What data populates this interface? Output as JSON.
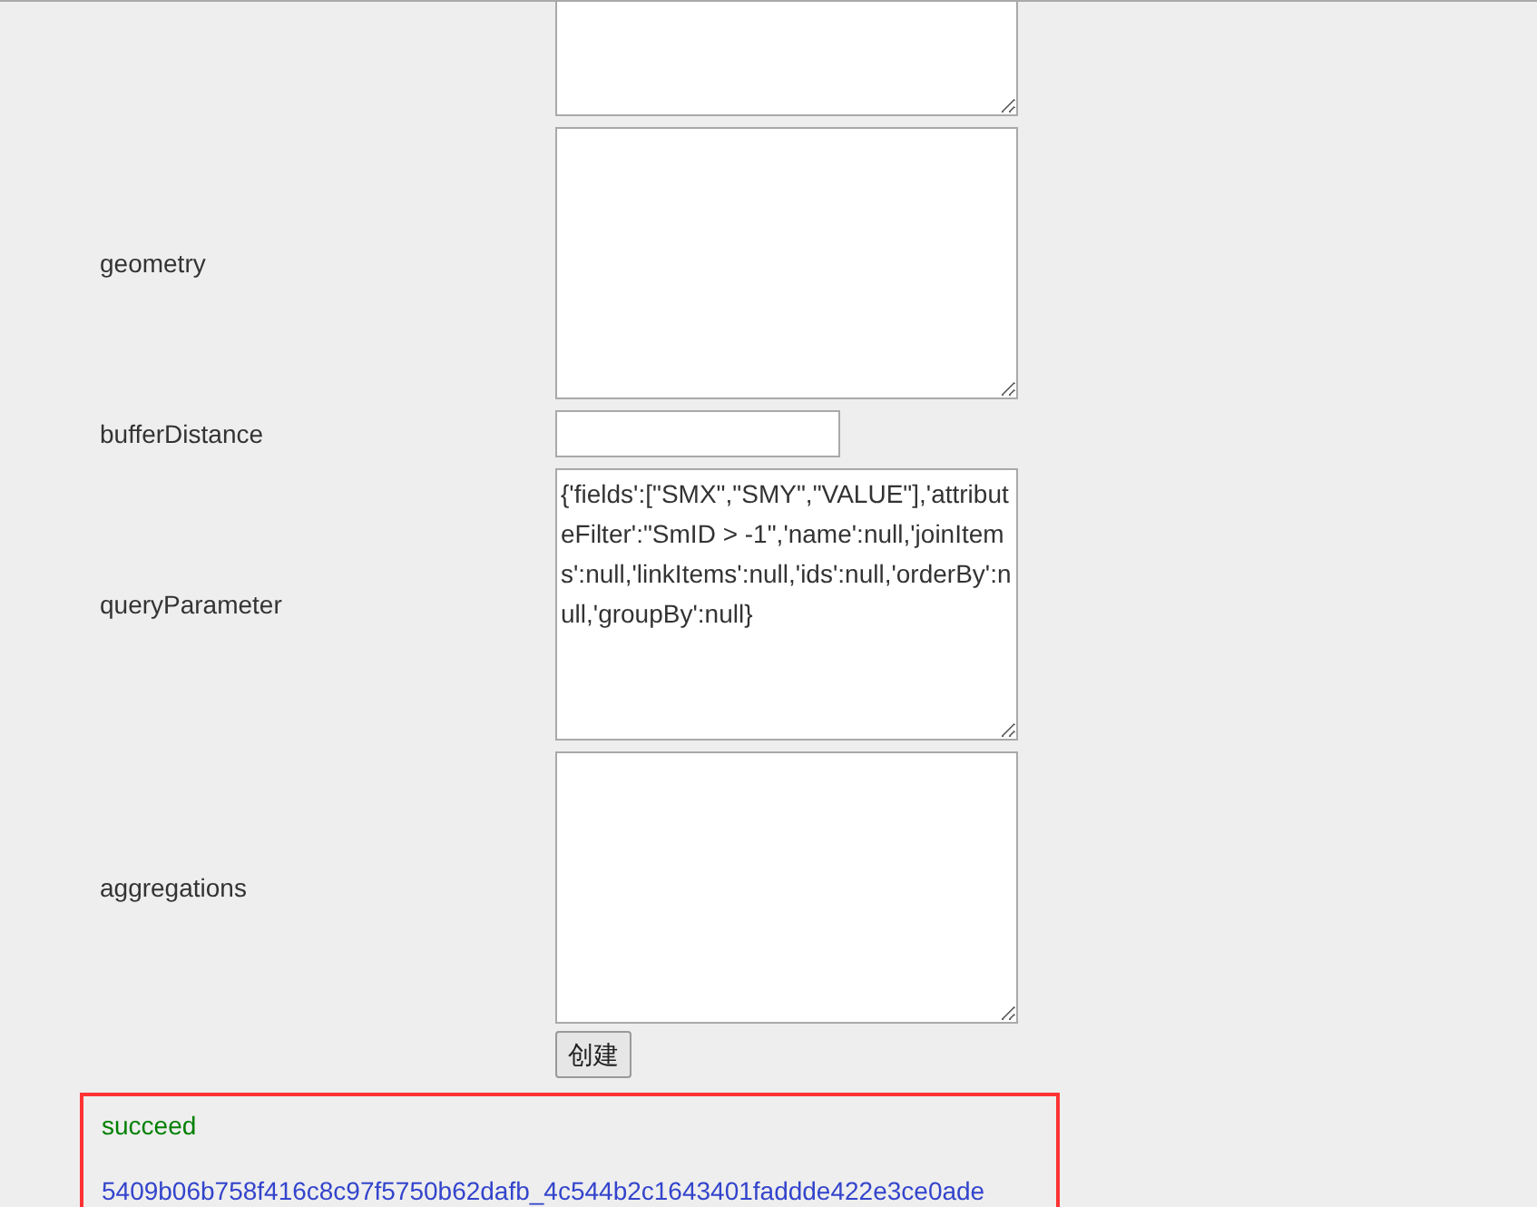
{
  "form": {
    "fields": [
      {
        "kind": "textarea_partial"
      },
      {
        "kind": "textarea",
        "label": "geometry"
      },
      {
        "kind": "input",
        "label": "bufferDistance"
      },
      {
        "kind": "textarea",
        "label": "queryParameter",
        "value": "{'fields':[\"SMX\",\"SMY\",\"VALUE\"],'attributeFilter':\"SmID > -1\",'name':null,'joinItems':null,'linkItems':null,'ids':null,'orderBy':null,'groupBy':null}"
      },
      {
        "kind": "textarea",
        "label": "aggregations"
      }
    ],
    "submit": "创建"
  },
  "result": {
    "status": "succeed",
    "link": "5409b06b758f416c8c97f5750b62dafb_4c544b2c1643401faddde422e3ce0ade"
  }
}
